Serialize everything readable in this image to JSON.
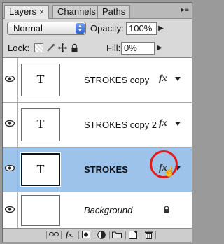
{
  "tabs": [
    {
      "label": "Layers",
      "close": "×"
    },
    {
      "label": "Channels"
    },
    {
      "label": "Paths"
    }
  ],
  "blend_mode": {
    "value": "Normal",
    "arrows": "▲▼"
  },
  "opacity": {
    "label": "Opacity:",
    "value": "100%"
  },
  "lock": {
    "label": "Lock:"
  },
  "fill": {
    "label": "Fill:",
    "value": "0%"
  },
  "layers": [
    {
      "name": "STROKES copy",
      "thumb_text": "T",
      "fx": "fx",
      "selected": false
    },
    {
      "name": "STROKES copy 2",
      "thumb_text": "T",
      "fx": "fx",
      "selected": false
    },
    {
      "name": "STROKES",
      "thumb_text": "T",
      "fx": "fx",
      "selected": true
    },
    {
      "name": "Background",
      "thumb_text": "",
      "locked": true
    }
  ],
  "toolbar_icons": [
    "link-icon",
    "fx-icon",
    "mask-icon",
    "adjustment-icon",
    "group-folder-icon",
    "new-layer-icon",
    "trash-icon"
  ],
  "toolbar": {
    "fx_label": "fx."
  },
  "highlight_color": "#e41919",
  "selection_color": "#9ec3ea"
}
